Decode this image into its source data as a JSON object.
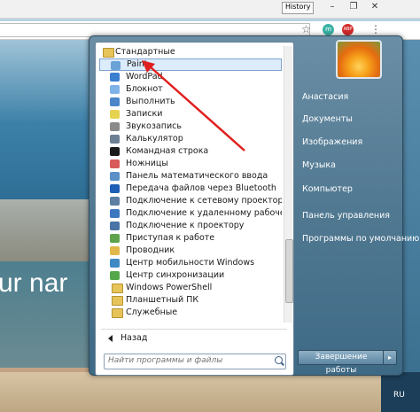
{
  "browser": {
    "history_label": "History",
    "ext1": "m",
    "ext2": "ABP"
  },
  "hero_text": "ur nar",
  "start_menu": {
    "folder": "Стандартные",
    "items": [
      {
        "label": "Paint",
        "icon": "paint-icon",
        "color": "#6aa2d8",
        "selected": true
      },
      {
        "label": "WordPad",
        "icon": "wordpad-icon",
        "color": "#3b7fd0"
      },
      {
        "label": "Блокнот",
        "icon": "notepad-icon",
        "color": "#7fb3e8"
      },
      {
        "label": "Выполнить",
        "icon": "run-icon",
        "color": "#4c86c9"
      },
      {
        "label": "Записки",
        "icon": "sticky-notes-icon",
        "color": "#e6d34f"
      },
      {
        "label": "Звукозапись",
        "icon": "microphone-icon",
        "color": "#8a8a8a"
      },
      {
        "label": "Калькулятор",
        "icon": "calculator-icon",
        "color": "#6d7f93"
      },
      {
        "label": "Командная строка",
        "icon": "cmd-icon",
        "color": "#1a1a1a"
      },
      {
        "label": "Ножницы",
        "icon": "scissors-icon",
        "color": "#d95a5a"
      },
      {
        "label": "Панель математического ввода",
        "icon": "math-input-icon",
        "color": "#5a8fc8"
      },
      {
        "label": "Передача файлов через Bluetooth",
        "icon": "bluetooth-icon",
        "color": "#1f5fb5"
      },
      {
        "label": "Подключение к сетевому проектору",
        "icon": "network-projector-icon",
        "color": "#5c7ea3"
      },
      {
        "label": "Подключение к удаленному рабочему сто",
        "icon": "remote-desktop-icon",
        "color": "#3c78c0"
      },
      {
        "label": "Подключение к проектору",
        "icon": "projector-icon",
        "color": "#4a73a6"
      },
      {
        "label": "Приступая к работе",
        "icon": "getting-started-icon",
        "color": "#5ea34c"
      },
      {
        "label": "Проводник",
        "icon": "explorer-icon",
        "color": "#e1b84a"
      },
      {
        "label": "Центр мобильности Windows",
        "icon": "mobility-center-icon",
        "color": "#3f8ac5"
      },
      {
        "label": "Центр синхронизации",
        "icon": "sync-center-icon",
        "color": "#53a84a"
      }
    ],
    "subfolders": [
      {
        "label": "Windows PowerShell",
        "icon": "folder-icon"
      },
      {
        "label": "Планшетный ПК",
        "icon": "folder-icon"
      },
      {
        "label": "Служебные",
        "icon": "folder-icon"
      }
    ],
    "back_label": "Назад",
    "search_placeholder": "Найти программы и файлы",
    "right_links": [
      "Анастасия",
      "Документы",
      "Изображения",
      "Музыка",
      "Компьютер",
      "Панель управления",
      "Программы по умолчанию"
    ],
    "shutdown_label": "Завершение работы"
  },
  "taskbar": {
    "language": "RU"
  },
  "colors": {
    "selection": "#dcecfb",
    "arrow": "#e0201f",
    "menu_right": "#4f7790"
  }
}
